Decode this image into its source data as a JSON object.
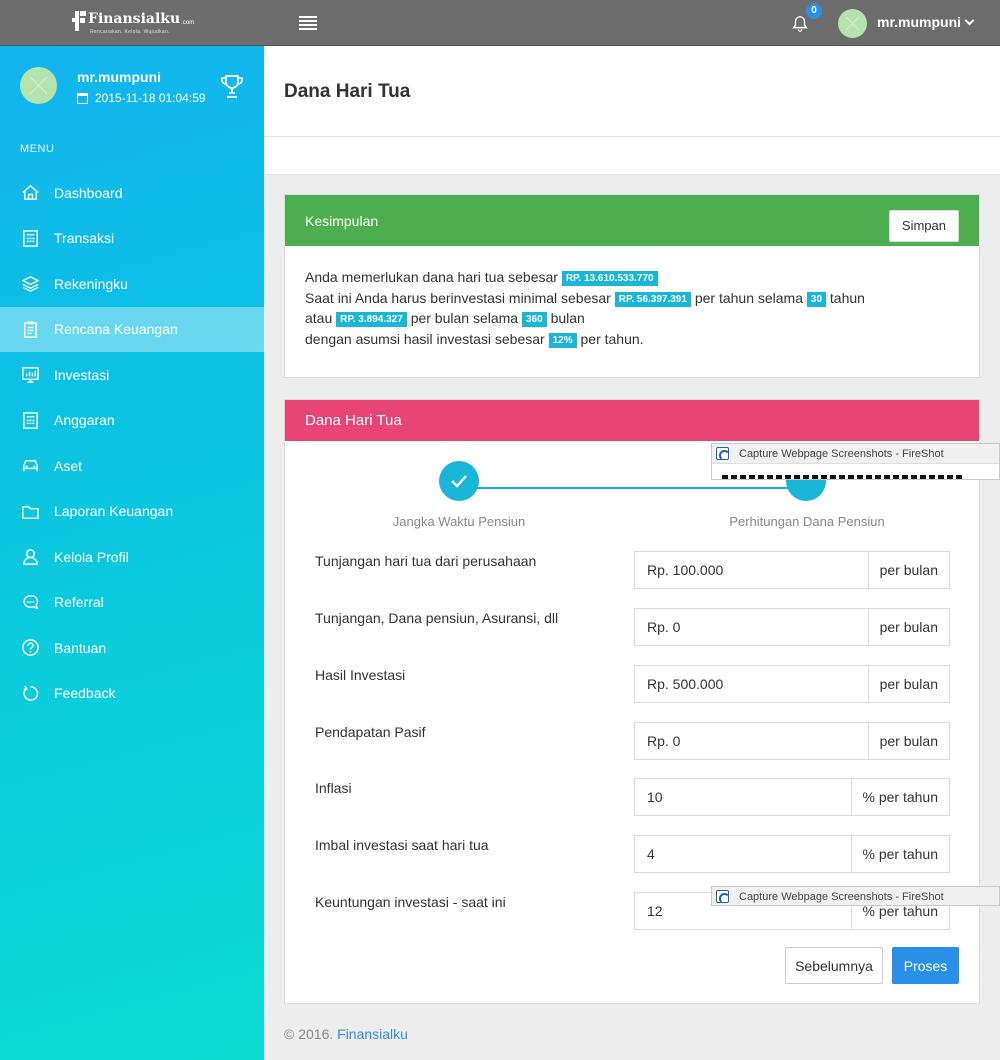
{
  "topbar": {
    "logo_text": "Finansialku",
    "logo_suffix": ".com",
    "logo_tagline": "Rencanakan. Kelola. Wujudkan.",
    "notification_count": "0",
    "username": "mr.mumpuni"
  },
  "sidebar": {
    "username": "mr.mumpuni",
    "datetime": "2015-11-18 01:04:59",
    "menu_label": "MENU",
    "items": [
      {
        "label": "Dashboard",
        "icon": "home-icon"
      },
      {
        "label": "Transaksi",
        "icon": "calculator-icon"
      },
      {
        "label": "Rekeningku",
        "icon": "layers-icon"
      },
      {
        "label": "Rencana Keuangan",
        "icon": "clipboard-icon",
        "active": true
      },
      {
        "label": "Investasi",
        "icon": "chart-icon"
      },
      {
        "label": "Anggaran",
        "icon": "calculator-icon"
      },
      {
        "label": "Aset",
        "icon": "car-icon"
      },
      {
        "label": "Laporan Keuangan",
        "icon": "folder-icon"
      },
      {
        "label": "Kelola Profil",
        "icon": "user-icon"
      },
      {
        "label": "Referral",
        "icon": "chat-icon"
      },
      {
        "label": "Bantuan",
        "icon": "help-icon"
      },
      {
        "label": "Feedback",
        "icon": "refresh-icon"
      }
    ]
  },
  "page": {
    "title": "Dana Hari Tua"
  },
  "summary": {
    "header": "Kesimpulan",
    "save_button": "Simpan",
    "line1_text": "Anda memerlukan dana hari tua sebesar",
    "line1_value": "RP. 13.610.533.770",
    "line2_text": "Saat ini Anda harus berinvestasi minimal sebesar",
    "line2_value": "RP. 56.397.391",
    "line2_mid": "per tahun selama",
    "line2_years": "30",
    "line2_end": "tahun",
    "line3_text": "atau",
    "line3_value": "RP. 3.894.327",
    "line3_mid": "per bulan selama",
    "line3_months": "360",
    "line3_end": "bulan",
    "line4_text": "dengan asumsi hasil investasi sebesar",
    "line4_value": "12%",
    "line4_end": "per tahun."
  },
  "form_panel": {
    "header": "Dana Hari Tua",
    "step1_label": "Jangka Waktu Pensiun",
    "step2_label": "Perhitungan Dana Pensiun",
    "fields": [
      {
        "label": "Tunjangan hari tua dari perusahaan",
        "value": "Rp. 100.000",
        "unit": "per bulan"
      },
      {
        "label": "Tunjangan, Dana pensiun, Asuransi, dll",
        "value": "Rp. 0",
        "unit": "per bulan"
      },
      {
        "label": "Hasil Investasi",
        "value": "Rp. 500.000",
        "unit": "per bulan"
      },
      {
        "label": "Pendapatan Pasif",
        "value": "Rp. 0",
        "unit": "per bulan"
      },
      {
        "label": "Inflasi",
        "value": "10",
        "unit": "% per tahun"
      },
      {
        "label": "Imbal investasi saat hari tua",
        "value": "4",
        "unit": "% per tahun"
      },
      {
        "label": "Keuntungan investasi - saat ini",
        "value": "12",
        "unit": "% per tahun"
      }
    ],
    "prev_button": "Sebelumnya",
    "next_button": "Proses"
  },
  "overlay": {
    "fireshot_title": "Capture Webpage Screenshots - FireShot"
  },
  "footer": {
    "copyright": "© 2016.",
    "brand_link": "Finansialku"
  },
  "colors": {
    "sidebar_top": "#12b4ee",
    "sidebar_bottom": "#0adcd2",
    "topbar": "#6c6c6c",
    "summary_header": "#4cae4f",
    "form_header": "#e84476",
    "accent": "#1ab6d7",
    "primary_button": "#2a8fe6"
  }
}
